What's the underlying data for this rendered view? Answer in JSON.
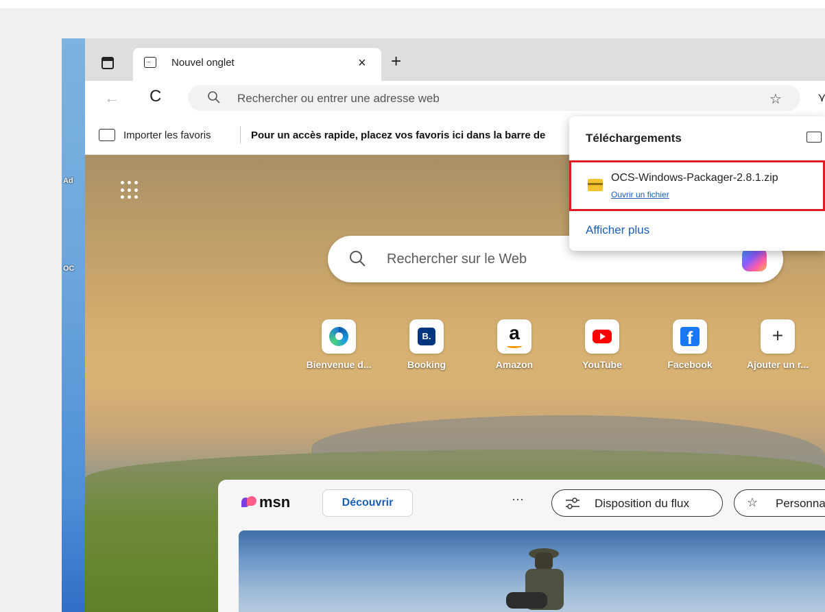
{
  "browser": {
    "tab": {
      "title": "Nouvel onglet",
      "close": "×"
    },
    "new_tab": "+",
    "toolbar": {
      "back": "←",
      "reload": "C",
      "address_placeholder": "Rechercher ou entrer une adresse web"
    },
    "favorites_bar": {
      "import_label": "Importer les favoris",
      "hint": "Pour un accès rapide, placez vos favoris ici dans la barre de"
    }
  },
  "desktop": {
    "labels": [
      "Ad",
      "OC"
    ]
  },
  "ntp": {
    "search_placeholder": "Rechercher sur le Web",
    "quick_links": [
      {
        "label": "Bienvenue d...",
        "icon": "edge-icon"
      },
      {
        "label": "Booking",
        "icon": "booking-icon",
        "glyph": "B."
      },
      {
        "label": "Amazon",
        "icon": "amazon-icon",
        "glyph": "a"
      },
      {
        "label": "YouTube",
        "icon": "youtube-icon"
      },
      {
        "label": "Facebook",
        "icon": "facebook-icon",
        "glyph": "f"
      },
      {
        "label": "Ajouter un r...",
        "icon": "plus-icon",
        "glyph": "+"
      }
    ]
  },
  "msn": {
    "brand": "msn",
    "discover": "Découvrir",
    "more": "···",
    "layout": "Disposition du flux",
    "personalize": "Personnaliser"
  },
  "downloads": {
    "title": "Téléchargements",
    "item": {
      "file_name": "OCS-Windows-Packager-2.8.1.zip",
      "action": "Ouvrir un fichier"
    },
    "show_more": "Afficher plus"
  },
  "colors": {
    "accent": "#1a5fb4",
    "highlight": "#e01b24"
  }
}
